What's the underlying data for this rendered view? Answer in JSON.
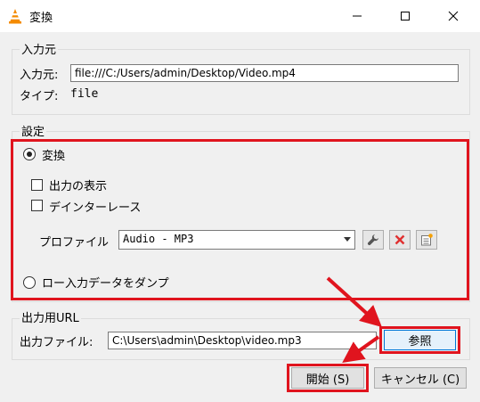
{
  "window": {
    "title": "変換",
    "icon": "vlc-cone-icon",
    "controls": [
      "minimize",
      "maximize",
      "close"
    ]
  },
  "source": {
    "group_title": "入力元",
    "source_label": "入力元:",
    "source_value": "file:///C:/Users/admin/Desktop/Video.mp4",
    "type_label": "タイプ:",
    "type_value": "file"
  },
  "settings": {
    "group_title": "設定",
    "convert_label": "変換",
    "convert_selected": true,
    "display_output_label": "出力の表示",
    "display_output_checked": false,
    "deinterlace_label": "デインターレース",
    "deinterlace_checked": false,
    "profile_label": "プロファイル",
    "profile_value": "Audio - MP3",
    "dump_raw_label": "ロー入力データをダンプ",
    "dump_raw_selected": false
  },
  "destination": {
    "group_title": "出力用URL",
    "file_label": "出力ファイル:",
    "file_value": "C:\\Users\\admin\\Desktop\\video.mp3",
    "browse_label": "参照"
  },
  "footer": {
    "start_label": "開始 (S)",
    "cancel_label": "キャンセル (C)"
  },
  "colors": {
    "highlight": "#e0141e",
    "arrow": "#e0141e",
    "delete_icon": "#e03030"
  }
}
